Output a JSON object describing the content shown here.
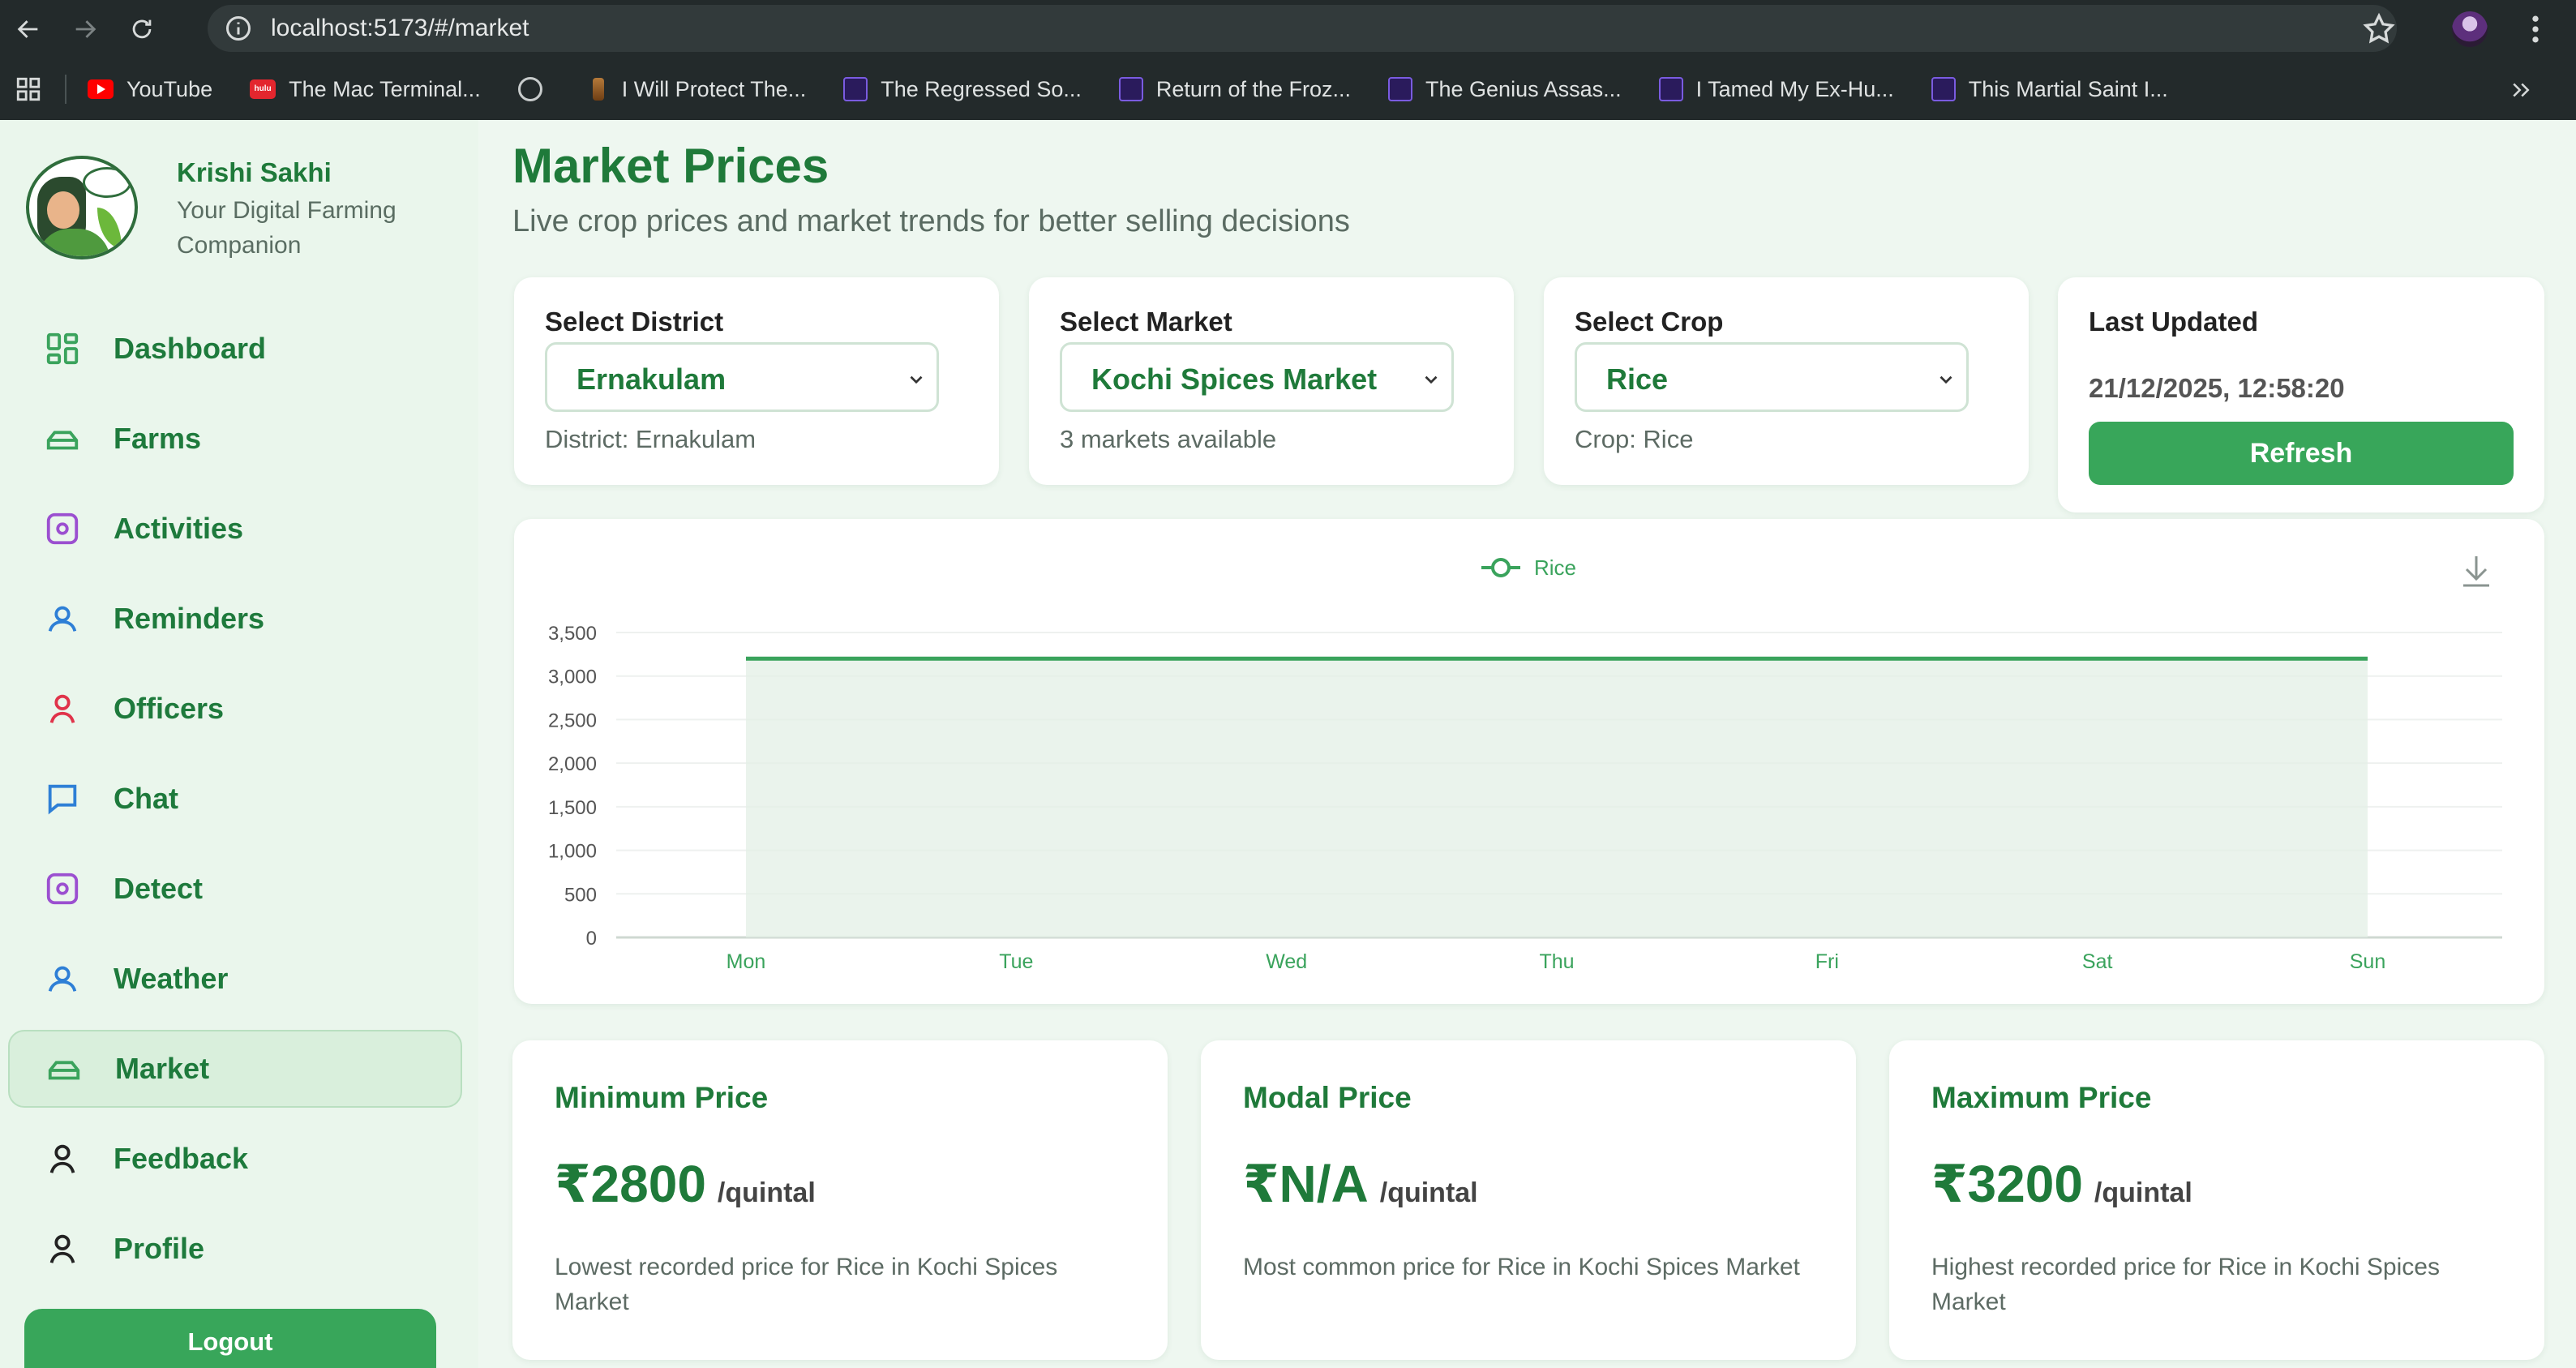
{
  "browser": {
    "url": "localhost:5173/#/market",
    "bookmarks": [
      {
        "label": "YouTube",
        "icon": "youtube-icon"
      },
      {
        "label": "The Mac Terminal...",
        "icon": "hulu-icon"
      },
      {
        "label": "",
        "icon": "globe-icon"
      },
      {
        "label": "I Will Protect The...",
        "icon": "bottle-icon"
      },
      {
        "label": "The Regressed So...",
        "icon": "k-icon"
      },
      {
        "label": "Return of the Froz...",
        "icon": "k-icon"
      },
      {
        "label": "The Genius Assas...",
        "icon": "k-icon"
      },
      {
        "label": "I Tamed My Ex-Hu...",
        "icon": "k-icon"
      },
      {
        "label": "This Martial Saint I...",
        "icon": "k-icon"
      }
    ]
  },
  "sidebar": {
    "brand_name": "Krishi Sakhi",
    "brand_tagline": "Your Digital Farming Companion",
    "items": [
      {
        "label": "Dashboard",
        "icon": "grid-icon",
        "color": "#3aa35c"
      },
      {
        "label": "Farms",
        "icon": "stack-icon",
        "color": "#3aa35c"
      },
      {
        "label": "Activities",
        "icon": "square-dot-icon",
        "color": "#9b4fd0"
      },
      {
        "label": "Reminders",
        "icon": "user-wave-icon",
        "color": "#2e7fd6"
      },
      {
        "label": "Officers",
        "icon": "person-icon",
        "color": "#e0334a"
      },
      {
        "label": "Chat",
        "icon": "chat-icon",
        "color": "#2e7fd6"
      },
      {
        "label": "Detect",
        "icon": "square-dot-icon",
        "color": "#9b4fd0"
      },
      {
        "label": "Weather",
        "icon": "user-wave-icon",
        "color": "#2e7fd6"
      },
      {
        "label": "Market",
        "icon": "stack-icon",
        "color": "#3aa35c",
        "active": true
      },
      {
        "label": "Feedback",
        "icon": "person-icon",
        "color": "#222222"
      },
      {
        "label": "Profile",
        "icon": "person-icon",
        "color": "#222222"
      }
    ],
    "logout_label": "Logout"
  },
  "header": {
    "title": "Market Prices",
    "subtitle": "Live crop prices and market trends for better selling decisions"
  },
  "filters": {
    "district": {
      "label": "Select District",
      "value": "Ernakulam",
      "hint": "District: Ernakulam"
    },
    "market": {
      "label": "Select Market",
      "value": "Kochi Spices Market",
      "hint": "3 markets available"
    },
    "crop": {
      "label": "Select Crop",
      "value": "Rice",
      "hint": "Crop: Rice"
    },
    "last_updated": {
      "label": "Last Updated",
      "value": "21/12/2025, 12:58:20",
      "button": "Refresh"
    }
  },
  "chart_data": {
    "type": "line",
    "x": [
      "Mon",
      "Tue",
      "Wed",
      "Thu",
      "Fri",
      "Sat",
      "Sun"
    ],
    "series": [
      {
        "name": "Rice",
        "values": [
          3200,
          3200,
          3200,
          3200,
          3200,
          3200,
          3200
        ],
        "color": "#3aa35c"
      }
    ],
    "y_ticks": [
      "0",
      "500",
      "1,000",
      "1,500",
      "2,000",
      "2,500",
      "3,000",
      "3,500"
    ],
    "ylim": [
      0,
      3500
    ],
    "grid": true,
    "legend": "top-center",
    "area_fill": true
  },
  "prices": [
    {
      "title": "Minimum Price",
      "amount": "₹2800",
      "unit": "/quintal",
      "desc": "Lowest recorded price for Rice in Kochi Spices Market"
    },
    {
      "title": "Modal Price",
      "amount": "₹N/A",
      "unit": "/quintal",
      "desc": "Most common price for Rice in Kochi Spices Market"
    },
    {
      "title": "Maximum Price",
      "amount": "₹3200",
      "unit": "/quintal",
      "desc": "Highest recorded price for Rice in Kochi Spices Market"
    }
  ]
}
